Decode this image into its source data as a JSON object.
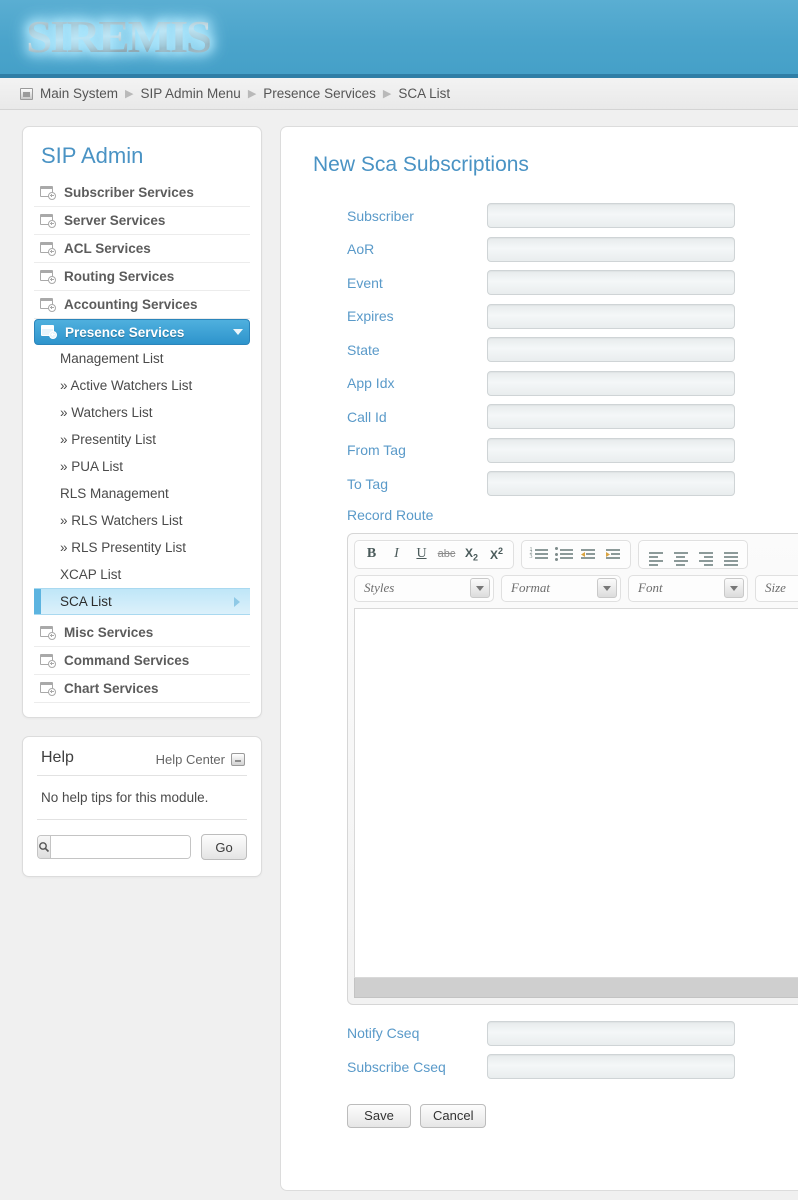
{
  "header": {
    "logo_text": "SIREMIS"
  },
  "breadcrumb": {
    "icon": "window-icon",
    "items": [
      "Main System",
      "SIP Admin Menu",
      "Presence Services",
      "SCA List"
    ],
    "separator": "▶"
  },
  "sidebar": {
    "title": "SIP Admin",
    "top_items": [
      {
        "label": "Subscriber Services",
        "icon": "window-add-icon"
      },
      {
        "label": "Server Services",
        "icon": "window-add-icon"
      },
      {
        "label": "ACL Services",
        "icon": "window-add-icon"
      },
      {
        "label": "Routing Services",
        "icon": "window-add-icon"
      },
      {
        "label": "Accounting Services",
        "icon": "window-add-icon"
      },
      {
        "label": "Presence Services",
        "icon": "window-add-icon",
        "active": true,
        "caret": "chevron-down-icon"
      }
    ],
    "sub_items": [
      {
        "label": "Management List"
      },
      {
        "label": "» Active Watchers List"
      },
      {
        "label": "» Watchers List"
      },
      {
        "label": "» Presentity List"
      },
      {
        "label": "» PUA List"
      },
      {
        "label": "RLS Management"
      },
      {
        "label": "» RLS Watchers List"
      },
      {
        "label": "» RLS Presentity List"
      },
      {
        "label": "XCAP List"
      },
      {
        "label": "SCA List",
        "selected": true
      }
    ],
    "bottom_items": [
      {
        "label": "Misc Services",
        "icon": "window-add-icon"
      },
      {
        "label": "Command Services",
        "icon": "window-add-icon"
      },
      {
        "label": "Chart Services",
        "icon": "window-add-icon"
      }
    ],
    "active_color": "#2e94cc",
    "selected_color": "#bfe6f8"
  },
  "help": {
    "title": "Help",
    "center_link": "Help Center",
    "center_icon": "minimize-icon",
    "body_text": "No help tips for this module.",
    "search_icon": "search-icon",
    "search_value": "",
    "search_placeholder": "",
    "go_label": "Go"
  },
  "main": {
    "title": "New Sca Subscriptions",
    "fields": [
      {
        "label": "Subscriber",
        "value": ""
      },
      {
        "label": "AoR",
        "value": ""
      },
      {
        "label": "Event",
        "value": ""
      },
      {
        "label": "Expires",
        "value": ""
      },
      {
        "label": "State",
        "value": ""
      },
      {
        "label": "App Idx",
        "value": ""
      },
      {
        "label": "Call Id",
        "value": ""
      },
      {
        "label": "From Tag",
        "value": ""
      },
      {
        "label": "To Tag",
        "value": ""
      }
    ],
    "record_route_label": "Record Route",
    "editor": {
      "toolbar_groups": [
        {
          "name": "text-format",
          "buttons": [
            {
              "name": "bold-icon",
              "glyph": "B"
            },
            {
              "name": "italic-icon",
              "glyph": "I"
            },
            {
              "name": "underline-icon",
              "glyph": "U"
            },
            {
              "name": "strikethrough-icon",
              "glyph": "abc"
            },
            {
              "name": "subscript-icon",
              "glyph": "X₂"
            },
            {
              "name": "superscript-icon",
              "glyph": "X²"
            }
          ]
        },
        {
          "name": "list-indent",
          "buttons": [
            {
              "name": "numbered-list-icon",
              "glyph": ""
            },
            {
              "name": "bulleted-list-icon",
              "glyph": ""
            },
            {
              "name": "decrease-indent-icon",
              "glyph": ""
            },
            {
              "name": "increase-indent-icon",
              "glyph": ""
            }
          ]
        },
        {
          "name": "alignment",
          "buttons": [
            {
              "name": "align-left-icon",
              "glyph": ""
            },
            {
              "name": "align-center-icon",
              "glyph": ""
            },
            {
              "name": "align-right-icon",
              "glyph": ""
            },
            {
              "name": "align-justify-icon",
              "glyph": ""
            }
          ]
        }
      ],
      "selects": [
        {
          "name": "styles-select",
          "label": "Styles"
        },
        {
          "name": "format-select",
          "label": "Format"
        },
        {
          "name": "font-select",
          "label": "Font"
        },
        {
          "name": "size-select",
          "label": "Size"
        }
      ],
      "content": ""
    },
    "bottom_fields": [
      {
        "label": "Notify Cseq",
        "value": ""
      },
      {
        "label": "Subscribe Cseq",
        "value": ""
      }
    ],
    "save_label": "Save",
    "cancel_label": "Cancel"
  },
  "colors": {
    "banner": "#4ba4cb",
    "accent": "#4a93c4",
    "label": "#5a9ac9"
  }
}
